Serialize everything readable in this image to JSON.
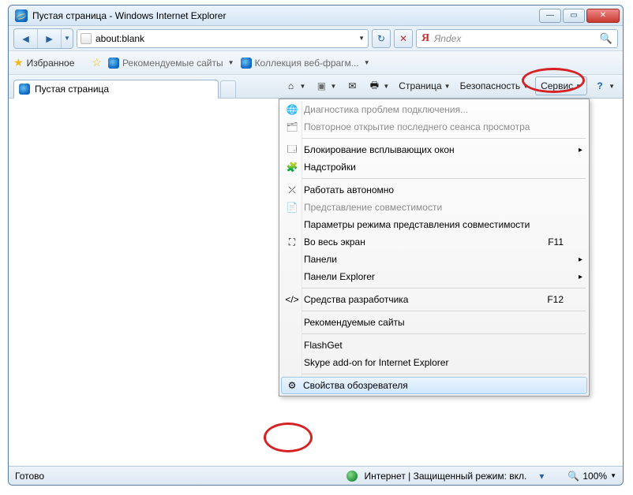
{
  "window": {
    "title": "Пустая страница - Windows Internet Explorer"
  },
  "address_bar": {
    "url": "about:blank"
  },
  "search_box": {
    "placeholder": "Яndex"
  },
  "favorites_bar": {
    "favorites_label": "Избранное",
    "suggested_sites": "Рекомендуемые сайты",
    "web_slice": "Коллекция веб-фрагм..."
  },
  "tab": {
    "title": "Пустая страница"
  },
  "command_bar": {
    "page": "Страница",
    "safety": "Безопасность",
    "tools": "Сервис"
  },
  "tools_menu": {
    "items": [
      {
        "label": "Диагностика проблем подключения...",
        "icon": "globe",
        "disabled": true
      },
      {
        "label": "Повторное открытие последнего сеанса просмотра",
        "icon": "reopen",
        "disabled": true
      },
      {
        "sep": true
      },
      {
        "label": "Блокирование всплывающих окон",
        "icon": "popup",
        "submenu": true
      },
      {
        "label": "Надстройки",
        "icon": "addons"
      },
      {
        "sep": true
      },
      {
        "label": "Работать автономно",
        "icon": "offline"
      },
      {
        "label": "Представление совместимости",
        "icon": "compat",
        "disabled": true
      },
      {
        "label": "Параметры режима представления совместимости"
      },
      {
        "label": "Во весь экран",
        "icon": "fullscreen",
        "shortcut": "F11"
      },
      {
        "label": "Панели",
        "submenu": true
      },
      {
        "label": "Панели Explorer",
        "submenu": true
      },
      {
        "sep": true
      },
      {
        "label": "Средства разработчика",
        "icon": "devtools",
        "shortcut": "F12"
      },
      {
        "sep": true
      },
      {
        "label": "Рекомендуемые сайты"
      },
      {
        "sep": true
      },
      {
        "label": "FlashGet"
      },
      {
        "label": "Skype add-on for Internet Explorer"
      },
      {
        "sep": true
      },
      {
        "label": "Свойства обозревателя",
        "icon": "options",
        "highlight": true
      }
    ]
  },
  "status_bar": {
    "ready": "Готово",
    "zone": "Интернет | Защищенный режим: вкл.",
    "zoom": "100%"
  }
}
